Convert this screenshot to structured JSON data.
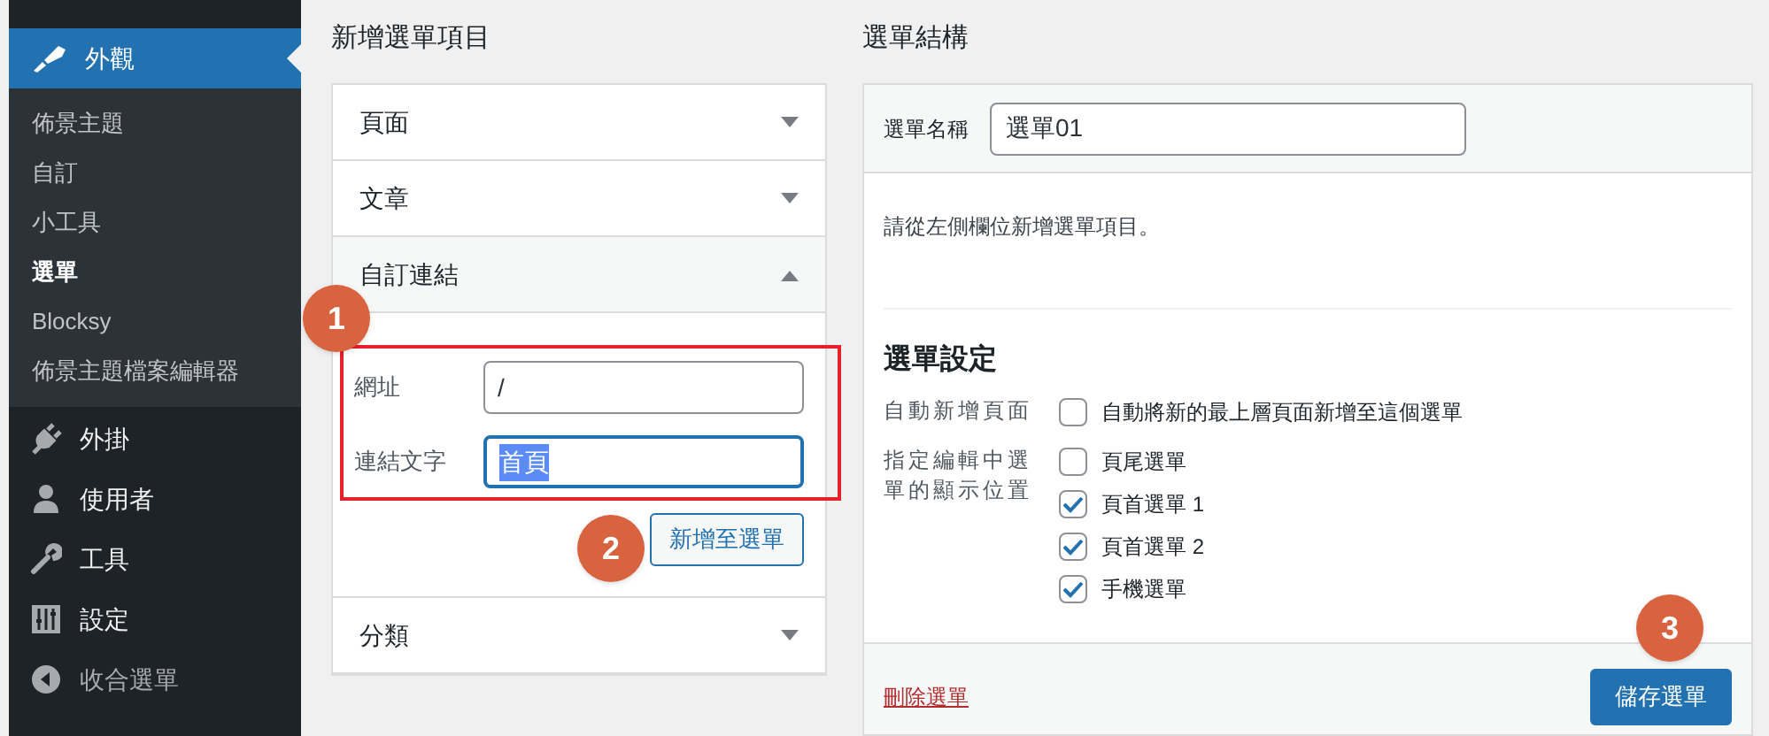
{
  "sidebar": {
    "active_item": {
      "label": "外觀",
      "selected": true
    },
    "submenu": [
      {
        "label": "佈景主題",
        "selected": false
      },
      {
        "label": "自訂",
        "selected": false
      },
      {
        "label": "小工具",
        "selected": false
      },
      {
        "label": "選單",
        "selected": true
      },
      {
        "label": "Blocksy",
        "selected": false
      },
      {
        "label": "佈景主題檔案編輯器",
        "selected": false
      }
    ],
    "items": [
      {
        "label": "外掛",
        "kind": "plug"
      },
      {
        "label": "使用者",
        "kind": "user"
      },
      {
        "label": "工具",
        "kind": "wrench"
      },
      {
        "label": "設定",
        "kind": "sliders"
      },
      {
        "label": "收合選單",
        "kind": "collapse"
      }
    ]
  },
  "add_items": {
    "title": "新增選單項目",
    "sections": [
      {
        "label": "頁面",
        "expanded": false
      },
      {
        "label": "文章",
        "expanded": false
      },
      {
        "label": "自訂連結",
        "expanded": true,
        "fields": [
          {
            "label": "網址",
            "value": "/",
            "focused": false
          },
          {
            "label": "連結文字",
            "value": "首頁",
            "focused": true
          }
        ],
        "button": "新增至選單"
      },
      {
        "label": "分類",
        "expanded": false
      }
    ]
  },
  "menu_structure": {
    "title": "選單結構",
    "name_label": "選單名稱",
    "name_value": "選單01",
    "hint": "請從左側欄位新增選單項目。",
    "settings_title": "選單設定",
    "settings": [
      {
        "label": "自動新增頁面",
        "options": [
          {
            "label": "自動將新的最上層頁面新增至這個選單",
            "checked": false
          }
        ]
      },
      {
        "label": "指定編輯中選單的顯示位置",
        "options": [
          {
            "label": "頁尾選單",
            "checked": false
          },
          {
            "label": "頁首選單 1",
            "checked": true
          },
          {
            "label": "頁首選單 2",
            "checked": true
          },
          {
            "label": "手機選單",
            "checked": true
          }
        ]
      }
    ],
    "delete_link": "刪除選單",
    "save_button": "儲存選單"
  },
  "annotations": [
    "1",
    "2",
    "3"
  ]
}
